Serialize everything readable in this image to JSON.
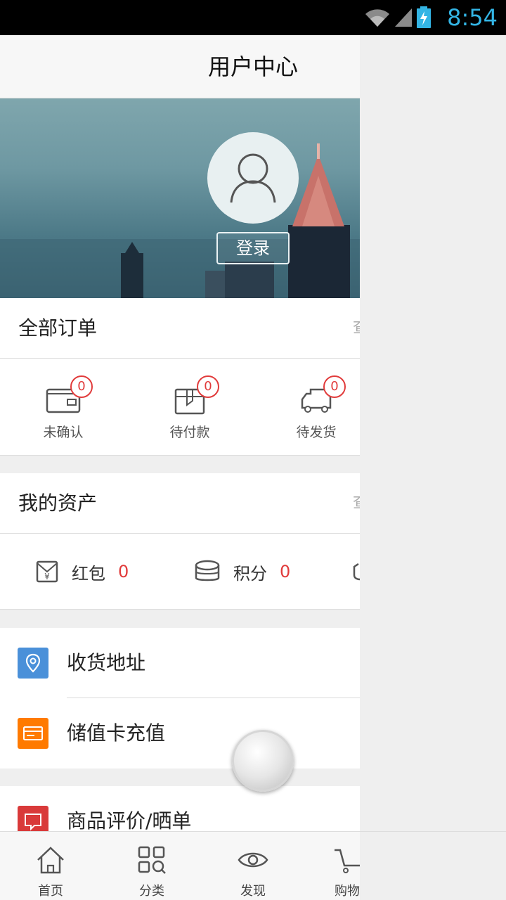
{
  "status_bar": {
    "time": "8:54"
  },
  "header": {
    "title": "用户中心"
  },
  "profile": {
    "login_label": "登录"
  },
  "orders_section": {
    "title": "全部订单",
    "more_label": "查",
    "items": [
      {
        "label": "未确认",
        "count": "0"
      },
      {
        "label": "待付款",
        "count": "0"
      },
      {
        "label": "待发货",
        "count": "0"
      }
    ]
  },
  "assets_section": {
    "title": "我的资产",
    "more_label": "查",
    "items": [
      {
        "label": "红包",
        "value": "0"
      },
      {
        "label": "积分",
        "value": "0"
      }
    ]
  },
  "menu": [
    {
      "label": "收货地址",
      "color": "#4a90d9"
    },
    {
      "label": "储值卡充值",
      "color": "#ff7a00"
    },
    {
      "label": "商品评价/晒单",
      "color": "#d93a3a"
    }
  ],
  "tabbar": [
    {
      "label": "首页"
    },
    {
      "label": "分类"
    },
    {
      "label": "发现"
    },
    {
      "label": "购物"
    }
  ],
  "colors": {
    "accent": "#e13b3b",
    "time": "#33b5e5"
  }
}
